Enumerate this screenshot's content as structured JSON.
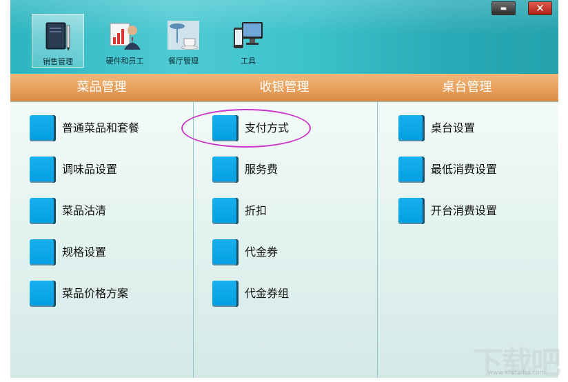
{
  "toolbar": {
    "items": [
      {
        "label": "销售管理",
        "icon": "notebook-pen-icon",
        "active": true
      },
      {
        "label": "硬件和员工",
        "icon": "staff-chart-icon",
        "active": false
      },
      {
        "label": "餐厅管理",
        "icon": "coffee-table-icon",
        "active": false
      },
      {
        "label": "工具",
        "icon": "devices-icon",
        "active": false
      }
    ],
    "window_controls": {
      "minimize": "▬",
      "close": "✕"
    }
  },
  "categories": [
    "菜品管理",
    "收银管理",
    "桌台管理"
  ],
  "columns": [
    {
      "items": [
        "普通菜品和套餐",
        "调味品设置",
        "菜品沽清",
        "规格设置",
        "菜品价格方案"
      ]
    },
    {
      "items": [
        "支付方式",
        "服务费",
        "折扣",
        "代金券",
        "代金券组"
      ]
    },
    {
      "items": [
        "桌台设置",
        "最低消费设置",
        "开台消费设置"
      ]
    }
  ],
  "watermark": {
    "text": "下载吧",
    "url": "www.xiazaiba.com"
  },
  "colors": {
    "toolbar_accent": "#3cc1cb",
    "category_bar": "#e9a25e",
    "menu_square": "#0aa6e6",
    "highlight_ring": "#cc33cc"
  }
}
